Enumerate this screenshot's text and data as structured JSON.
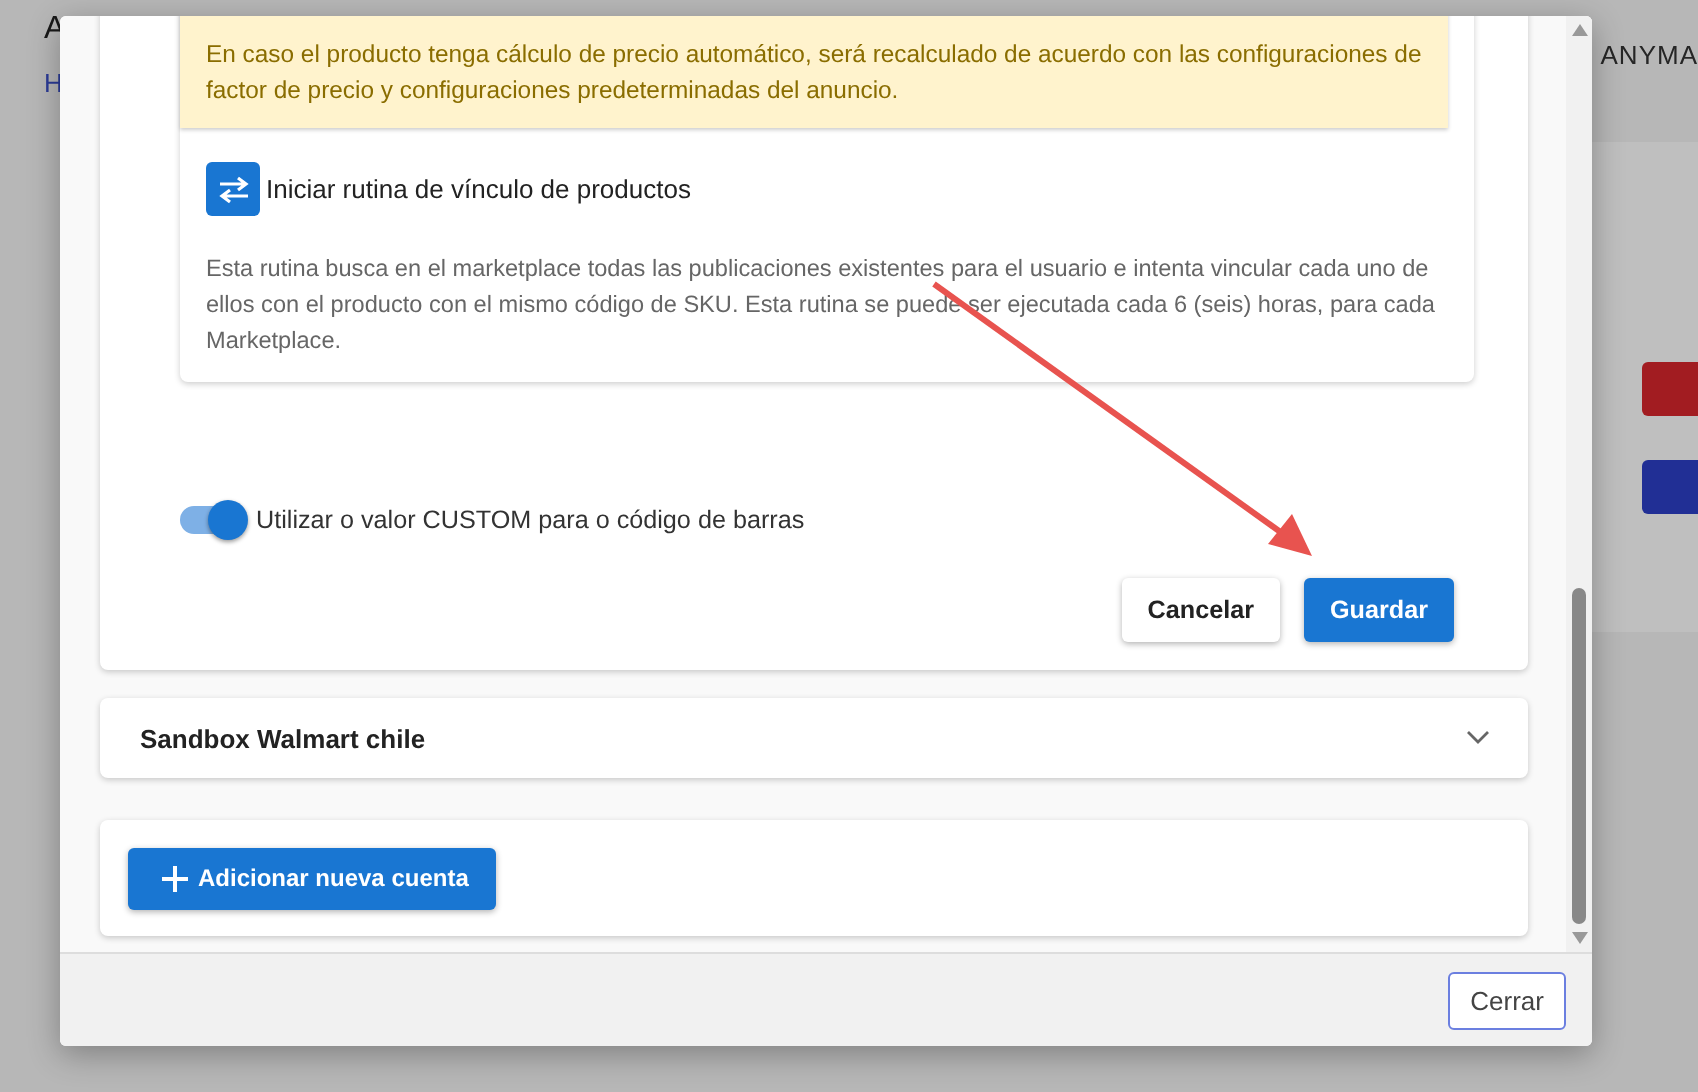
{
  "background_page": {
    "title": "A",
    "link": "H",
    "user": "ANYMA"
  },
  "modal": {
    "notice": {
      "lines": [
        "En caso el producto tenga cálculo de precio automático, será recalculado de acuerdo con las configuraciones de factor de precio y configuraciones predeterminadas del anuncio."
      ]
    },
    "routine": {
      "button_label": "Iniciar rutina de vínculo de productos",
      "description": "Esta rutina busca en el marketplace todas las publicaciones existentes para el usuario e intenta vincular cada uno de ellos con el producto con el mismo código de SKU. Esta rutina se puede ser ejecutada cada 6 (seis) horas, para cada Marketplace."
    },
    "toggle": {
      "label": "Utilizar o valor CUSTOM para o código de barras",
      "on": true
    },
    "actions": [
      "Cancelar",
      "Guardar"
    ],
    "accounts": [
      {
        "name": "Sandbox Walmart chile",
        "expanded": false
      }
    ],
    "add_button": "Adicionar nueva cuenta",
    "footer_button": "Cerrar"
  }
}
